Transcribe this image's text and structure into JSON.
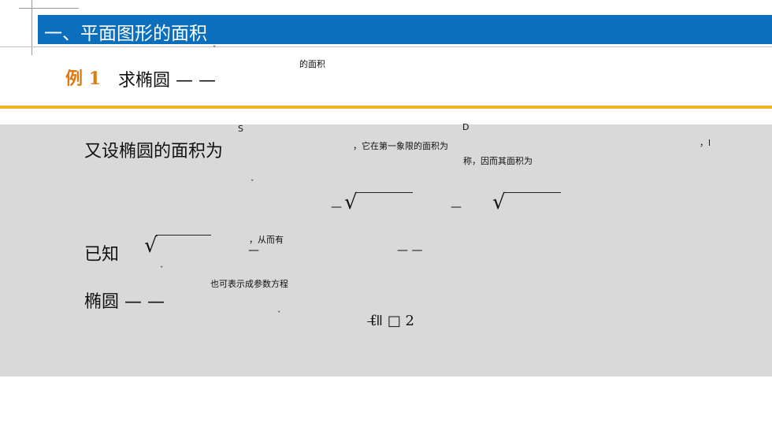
{
  "header": {
    "title": "一、平面图形的面积"
  },
  "example": {
    "label": "例 1",
    "question": "求椭圆 —   —",
    "tail": "的面积",
    "tick": "ˇ"
  },
  "solution": {
    "line1_lead": "又设椭圆的面积为",
    "line1_sup": "S",
    "line1_mid": "，它在第一象限的面积为",
    "line1_sup2": "D",
    "line1_right": "，l",
    "line1_sub": "称，因而其面积为",
    "line2_tick": "ˇ",
    "line2_dash1": "—",
    "line2_dash2": "—",
    "line3_lead": "已知",
    "line3_note": "，从而有",
    "line3_dash1": "—",
    "line3_dash2": "—  —",
    "line4_tick": "ˇ",
    "line4_lead": "椭圆 —   —",
    "line4_note": "也可表示成参数方程",
    "line5_tick": "ˇ",
    "line5_glyphs": "ƭ̶ǁ  □   2"
  }
}
